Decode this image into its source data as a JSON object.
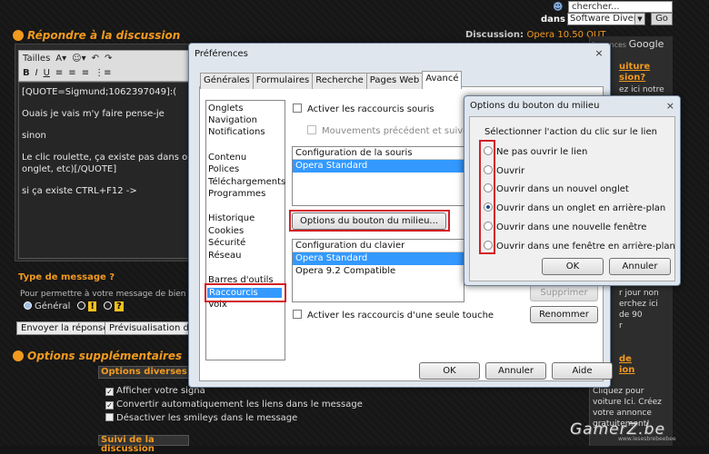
{
  "topbar": {
    "search_value": "chercher...",
    "dans_label": "dans",
    "scope_value": "Software Divers",
    "go_label": "Go"
  },
  "forum": {
    "reply_title": "Répondre à la discussion",
    "discussion_label": "Discussion:",
    "discussion_name": "Opera 10.50 OUT",
    "editor_toolbar": {
      "sizes_label": "Tailles"
    },
    "editor_lines": [
      "[QUOTE=Sigmund;1062397049]:(",
      "Ouais je vais m'y faire pense-je",
      "sinon",
      "Le clic roulette, ça existe pas dans ope",
      "onglet, etc)[/QUOTE]",
      "si ça existe CTRL+F12 ->"
    ],
    "message_type_title": "Type de message ?",
    "message_type_desc": "Pour permettre à votre message de bien re",
    "radio_general": "Général",
    "btn_send": "Envoyer la réponse",
    "btn_preview": "Prévisualisation du",
    "options_title": "Options supplémentaires",
    "diverse_title": "Options diverses",
    "check_signature": "Afficher votre signa",
    "check_links": "Convertir automatiquement les liens dans le message",
    "check_smileys": "Désactiver les smileys dans le message",
    "suivi_title": "Suivi de la discussion"
  },
  "ads": {
    "header": "Annonces",
    "brand": "Google",
    "link1": "uiture",
    "link1b": "sion?",
    "text1": "ez ici notre",
    "text2": "r jour non",
    "text3": "erchez ici",
    "text4": "de 90",
    "text5": "r",
    "link2": "de",
    "link2b": "ion",
    "text6": "Cliquez pour",
    "text7": "voiture Ici. Créez",
    "text8": "votre annonce",
    "text9": "gratuitement!",
    "watermark": "GamerZ.be",
    "watermark_url": "www.lesesbrebeebee"
  },
  "prefs": {
    "title": "Préférences",
    "close": "×",
    "tabs": [
      "Générales",
      "Formulaires",
      "Recherche",
      "Pages Web",
      "Avancé"
    ],
    "categories_group1": [
      "Onglets",
      "Navigation",
      "Notifications"
    ],
    "categories_group2": [
      "Contenu",
      "Polices",
      "Téléchargements",
      "Programmes"
    ],
    "categories_group3": [
      "Historique",
      "Cookies",
      "Sécurité",
      "Réseau"
    ],
    "categories_group4": [
      "Barres d'outils",
      "Raccourcis",
      "Voix"
    ],
    "check_mouse_shortcuts": "Activer les raccourcis souris",
    "check_mouse_gestures": "Mouvements précédent et suivant pour",
    "mouse_config_header": "Configuration de la souris",
    "mouse_config_rows": [
      "Opera Standard"
    ],
    "middle_button": "Options du bouton du milieu...",
    "keyboard_config_header": "Configuration du clavier",
    "keyboard_config_rows": [
      "Opera Standard",
      "Opera 9.2 Compatible"
    ],
    "btn_delete": "Supprimer",
    "btn_rename": "Renommer",
    "check_single_key": "Activer les raccourcis d'une seule touche",
    "btn_ok": "OK",
    "btn_cancel": "Annuler",
    "btn_help": "Aide"
  },
  "middle_dialog": {
    "title": "Options du bouton du milieu",
    "close": "×",
    "prompt": "Sélectionner l'action du clic sur le lien",
    "options": [
      "Ne pas ouvrir le lien",
      "Ouvrir",
      "Ouvrir dans un nouvel onglet",
      "Ouvrir dans un onglet en arrière-plan",
      "Ouvrir dans une nouvelle fenêtre",
      "Ouvrir dans une fenêtre en arrière-plan"
    ],
    "selected_index": 3,
    "btn_ok": "OK",
    "btn_cancel": "Annuler"
  }
}
